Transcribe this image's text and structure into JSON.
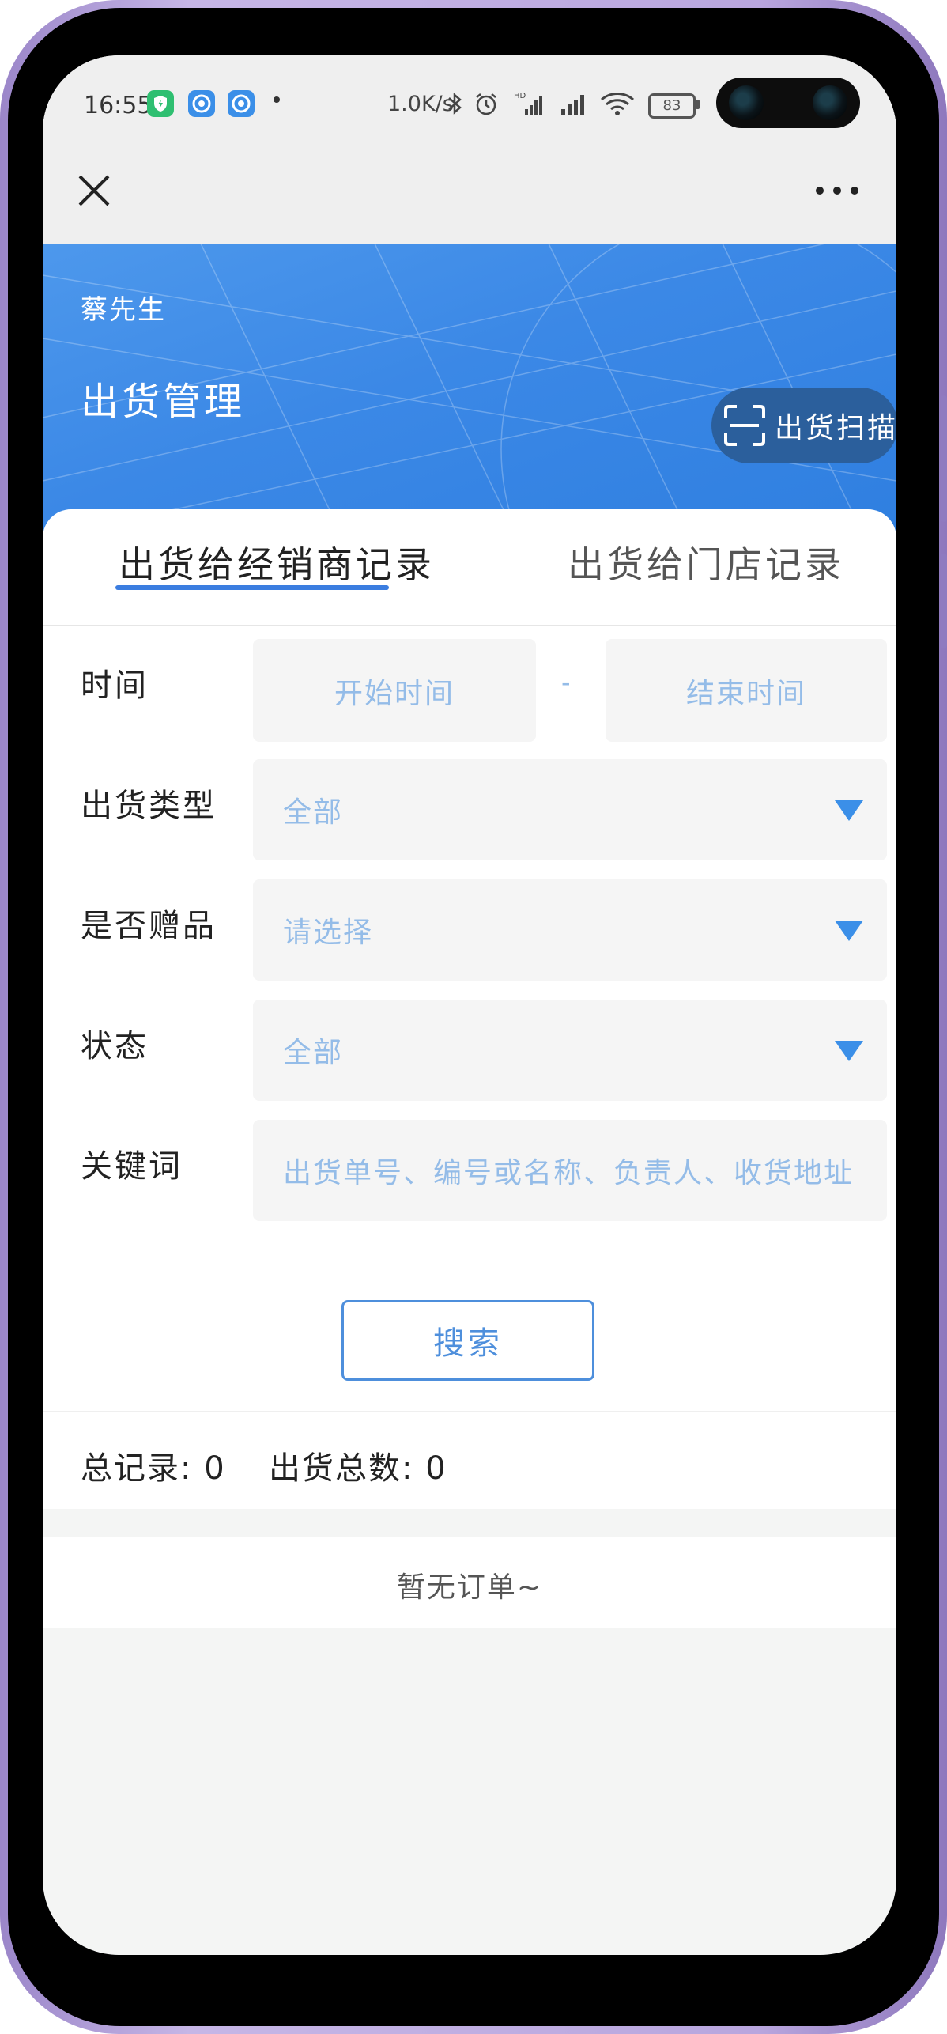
{
  "status_bar": {
    "time": "16:55",
    "net_speed": "1.0K/s",
    "battery": "83",
    "icons": [
      "shield-app-icon",
      "mobile-app-icon",
      "mobile-app-icon-2",
      "bluetooth-icon",
      "alarm-icon",
      "hd-signal-icon",
      "signal-icon",
      "wifi-icon",
      "battery-icon"
    ]
  },
  "nav": {
    "close_icon": "close-icon",
    "more_icon": "more-icon"
  },
  "header": {
    "user_name": "蔡先生",
    "title": "出货管理",
    "scan_button": "出货扫描",
    "accent_color": "#3b88e6"
  },
  "tabs": [
    {
      "label": "出货给经销商记录",
      "active": true
    },
    {
      "label": "出货给门店记录",
      "active": false
    }
  ],
  "filters": {
    "time": {
      "label": "时间",
      "start_placeholder": "开始时间",
      "separator": "-",
      "end_placeholder": "结束时间"
    },
    "ship_type": {
      "label": "出货类型",
      "value": "全部"
    },
    "gift": {
      "label": "是否赠品",
      "value": "请选择"
    },
    "status": {
      "label": "状态",
      "value": "全部"
    },
    "keyword": {
      "label": "关键词",
      "placeholder": "出货单号、编号或名称、负责人、收货地址"
    }
  },
  "search_button": "搜索",
  "summary": {
    "total_records_label": "总记录:",
    "total_records": "0",
    "total_shipments_label": "出货总数:",
    "total_shipments": "0"
  },
  "empty_message": "暂无订单~"
}
